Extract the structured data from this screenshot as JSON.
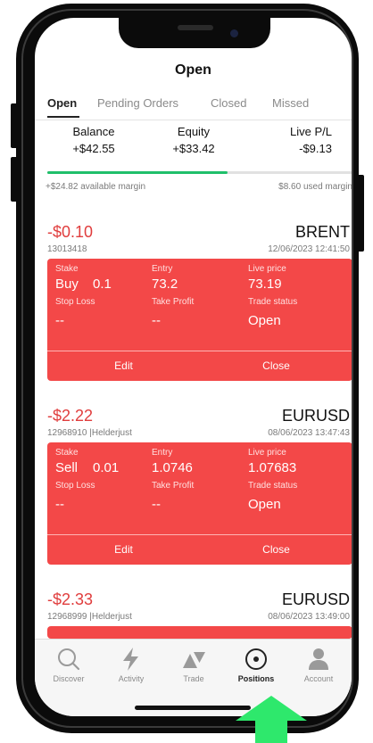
{
  "header": {
    "title": "Open"
  },
  "tabs": [
    "Open",
    "Pending Orders",
    "Closed",
    "Missed"
  ],
  "summary": {
    "balance_label": "Balance",
    "balance_value": "+$42.55",
    "equity_label": "Equity",
    "equity_value": "+$33.42",
    "livepl_label": "Live P/L",
    "livepl_value": "-$9.13",
    "margin_used_fraction": 0.59,
    "available_margin": "+$24.82 available margin",
    "used_margin": "$8.60 used margin"
  },
  "positions": [
    {
      "amount": "-$0.10",
      "symbol": "BRENT",
      "ref": "13013418",
      "time": "12/06/2023 12:41:50",
      "stake_label": "Stake",
      "side": "Buy",
      "stake": "0.1",
      "entry_label": "Entry",
      "entry": "73.2",
      "live_label": "Live price",
      "live": "73.19",
      "sl_label": "Stop Loss",
      "sl": "--",
      "tp_label": "Take Profit",
      "tp": "--",
      "status_label": "Trade status",
      "status": "Open",
      "edit": "Edit",
      "close": "Close"
    },
    {
      "amount": "-$2.22",
      "symbol": "EURUSD",
      "ref": "12968910 |Helderjust",
      "time": "08/06/2023 13:47:43",
      "stake_label": "Stake",
      "side": "Sell",
      "stake": "0.01",
      "entry_label": "Entry",
      "entry": "1.0746",
      "live_label": "Live price",
      "live": "1.07683",
      "sl_label": "Stop Loss",
      "sl": "--",
      "tp_label": "Take Profit",
      "tp": "--",
      "status_label": "Trade status",
      "status": "Open",
      "edit": "Edit",
      "close": "Close"
    },
    {
      "amount": "-$2.33",
      "symbol": "EURUSD",
      "ref": "12968999 |Helderjust",
      "time": "08/06/2023 13:49:00"
    }
  ],
  "nav": {
    "items": [
      {
        "label": "Discover",
        "icon": "search-icon"
      },
      {
        "label": "Activity",
        "icon": "lightning-icon"
      },
      {
        "label": "Trade",
        "icon": "trade-icon"
      },
      {
        "label": "Positions",
        "icon": "positions-icon"
      },
      {
        "label": "Account",
        "icon": "person-icon"
      }
    ],
    "active": "Positions"
  },
  "colors": {
    "card_red": "#f34848",
    "loss_text": "#e03d3d",
    "margin_bar": "#1fbf6a",
    "arrow_green": "#2ee86c"
  }
}
